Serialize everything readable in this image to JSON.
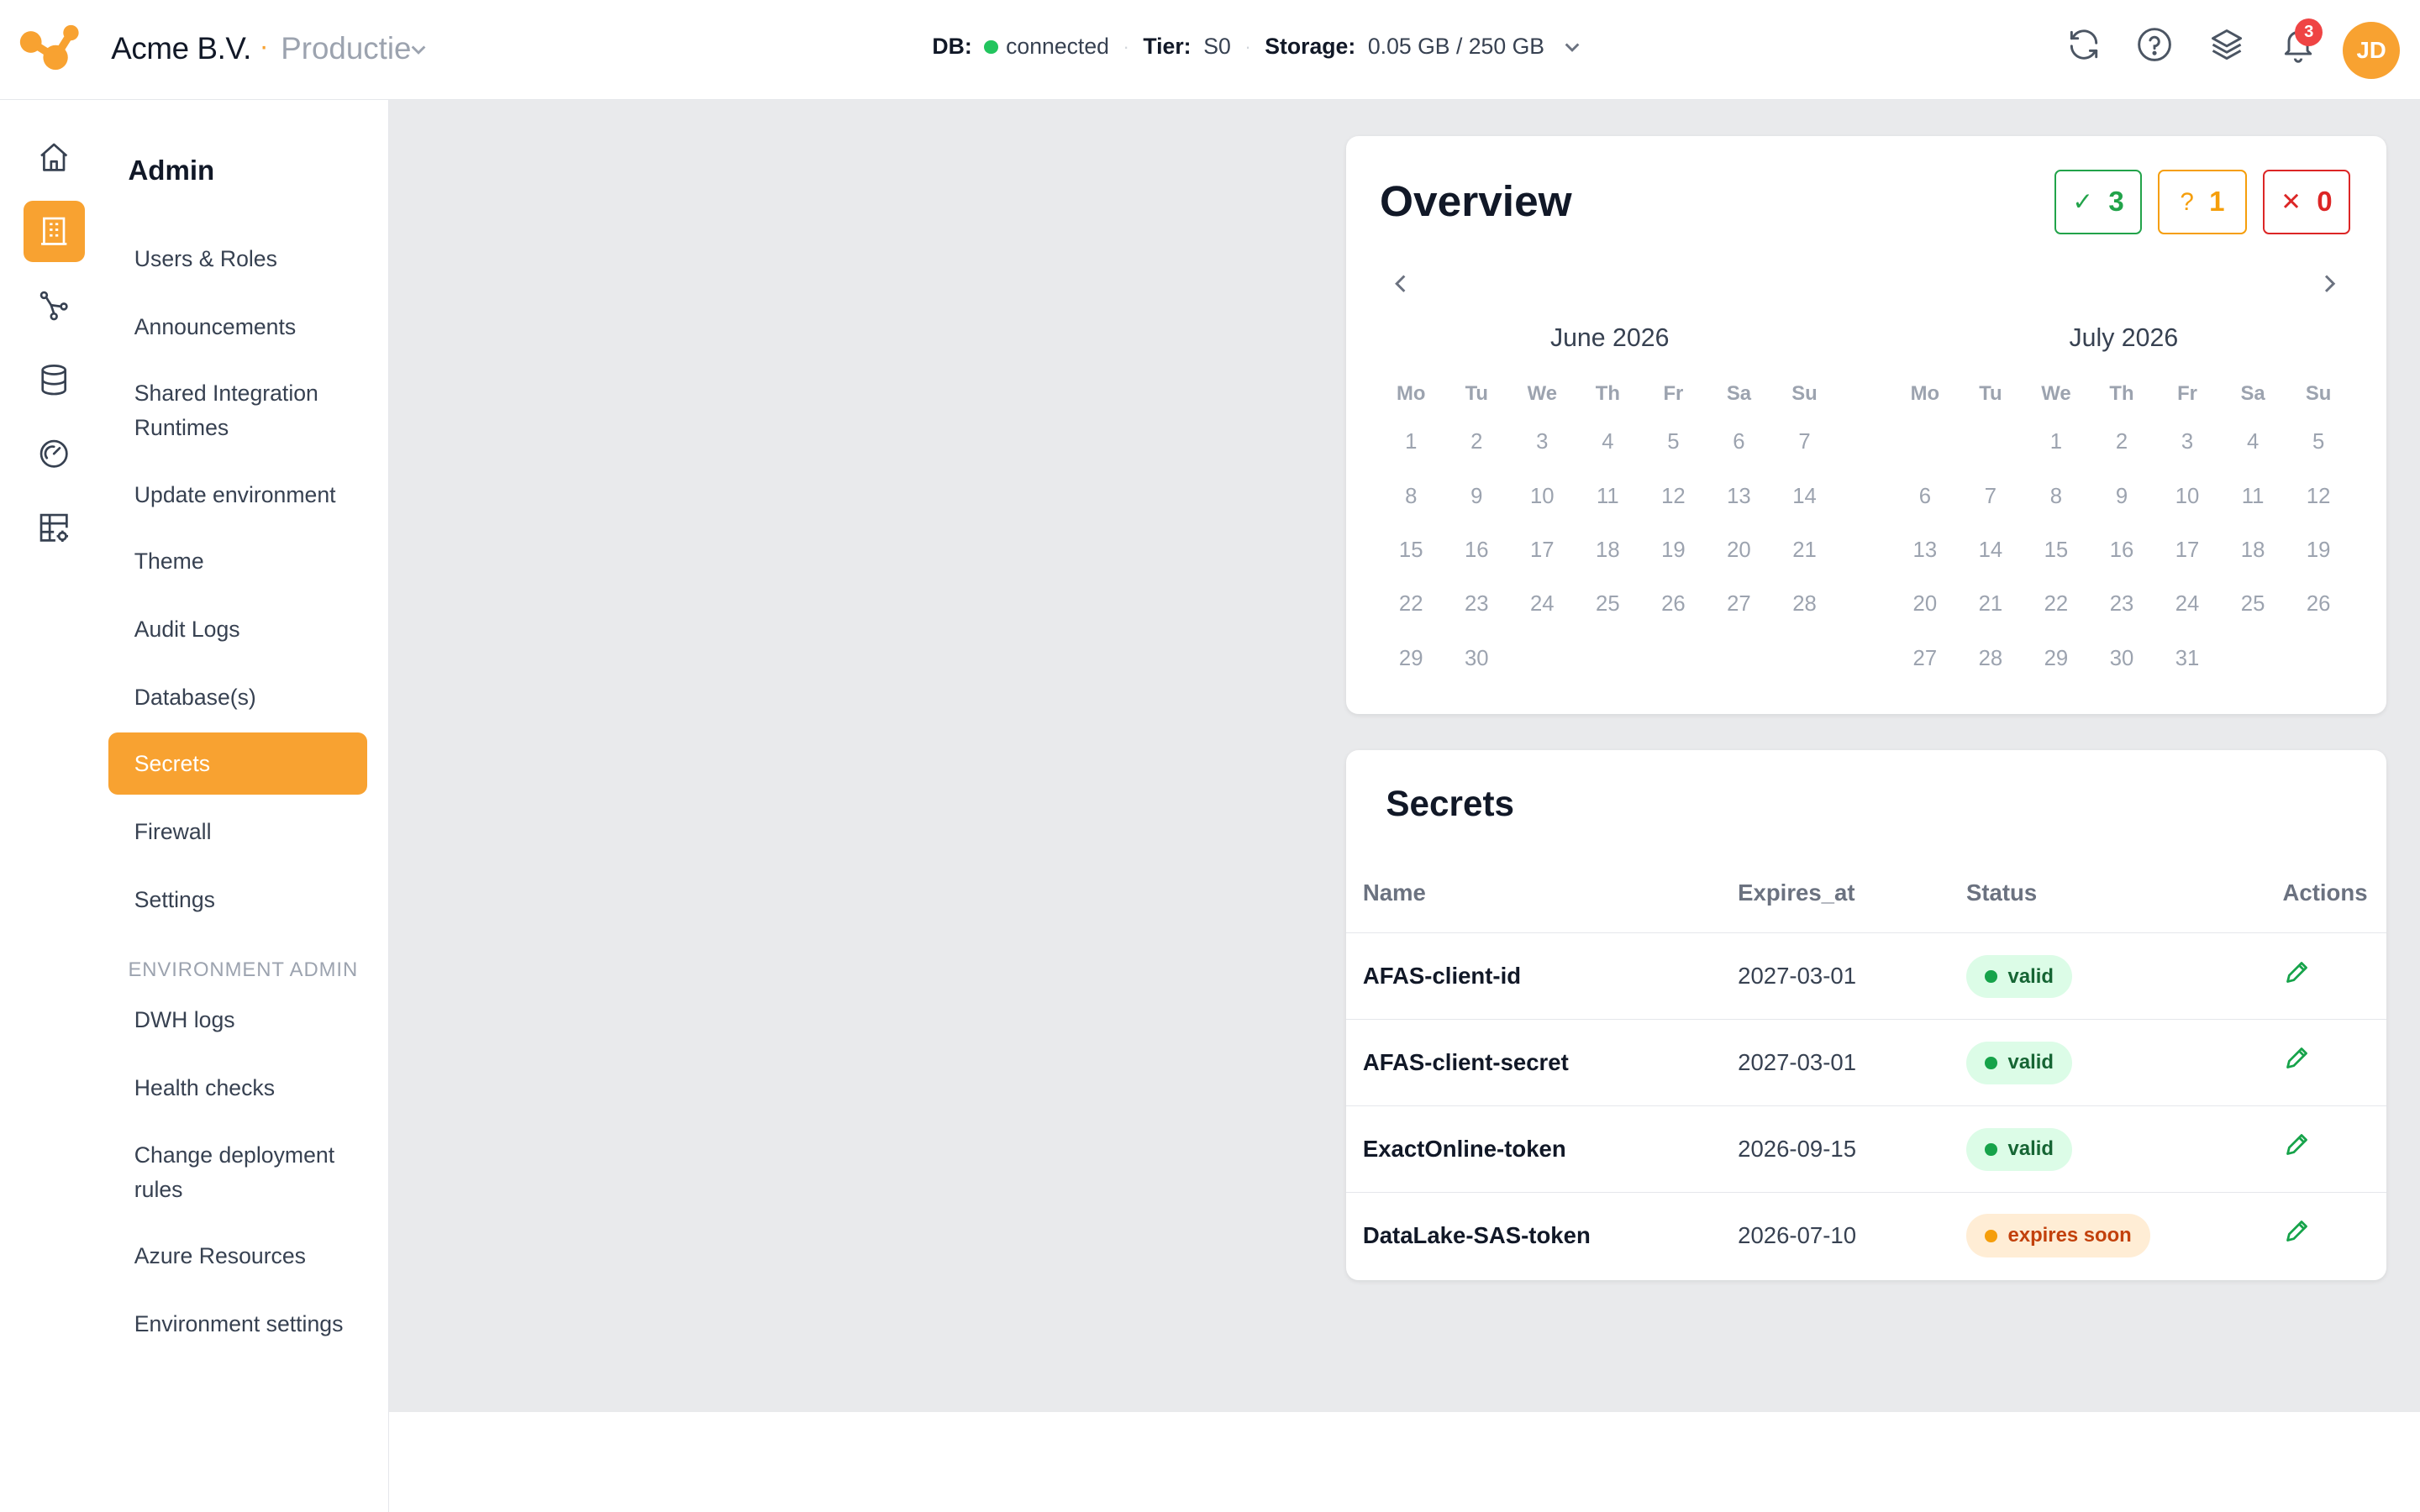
{
  "header": {
    "company": "Acme B.V.",
    "environment": "Productie",
    "db_label": "DB:",
    "db_status": "connected",
    "tier_label": "Tier:",
    "tier_value": "S0",
    "storage_label": "Storage:",
    "storage_value": "0.05 GB / 250 GB",
    "notification_count": "3",
    "avatar_initials": "JD",
    "icons": [
      "refresh-icon",
      "help-icon",
      "layers-icon",
      "bell-icon"
    ],
    "accent_color": "#f8a231"
  },
  "rail": {
    "items": [
      "home-icon",
      "building-icon",
      "flow-icon",
      "database-icon",
      "gauge-icon",
      "table-settings-icon"
    ],
    "active_index": 1
  },
  "sidenav": {
    "title": "Admin",
    "items": [
      {
        "label": "Users & Roles"
      },
      {
        "label": "Announcements"
      },
      {
        "label": "Shared Integration Runtimes"
      },
      {
        "label": "Update environment"
      },
      {
        "label": "Theme"
      },
      {
        "label": "Audit Logs"
      },
      {
        "label": "Database(s)"
      },
      {
        "label": "Secrets"
      },
      {
        "label": "Firewall"
      },
      {
        "label": "Settings"
      }
    ],
    "active_label": "Secrets",
    "section_title": "ENVIRONMENT ADMIN",
    "env_items": [
      {
        "label": "DWH logs"
      },
      {
        "label": "Health checks"
      },
      {
        "label": "Change deployment rules"
      },
      {
        "label": "Azure Resources"
      },
      {
        "label": "Environment settings"
      }
    ]
  },
  "overview": {
    "title": "Overview",
    "counts": {
      "ok": "3",
      "warn": "1",
      "error": "0"
    },
    "weekdays": [
      "Mo",
      "Tu",
      "We",
      "Th",
      "Fr",
      "Sa",
      "Su"
    ],
    "months": [
      {
        "title": "June 2026",
        "offset": 0,
        "days": 30
      },
      {
        "title": "July 2026",
        "offset": 2,
        "days": 31
      }
    ]
  },
  "secrets": {
    "title": "Secrets",
    "columns": {
      "name": "Name",
      "expires": "Expires_at",
      "status": "Status",
      "actions": "Actions"
    },
    "rows": [
      {
        "name": "AFAS-client-id",
        "expires_at": "2027-03-01",
        "status": "valid"
      },
      {
        "name": "AFAS-client-secret",
        "expires_at": "2027-03-01",
        "status": "valid"
      },
      {
        "name": "ExactOnline-token",
        "expires_at": "2026-09-15",
        "status": "valid"
      },
      {
        "name": "DataLake-SAS-token",
        "expires_at": "2026-07-10",
        "status": "expires soon"
      }
    ]
  }
}
